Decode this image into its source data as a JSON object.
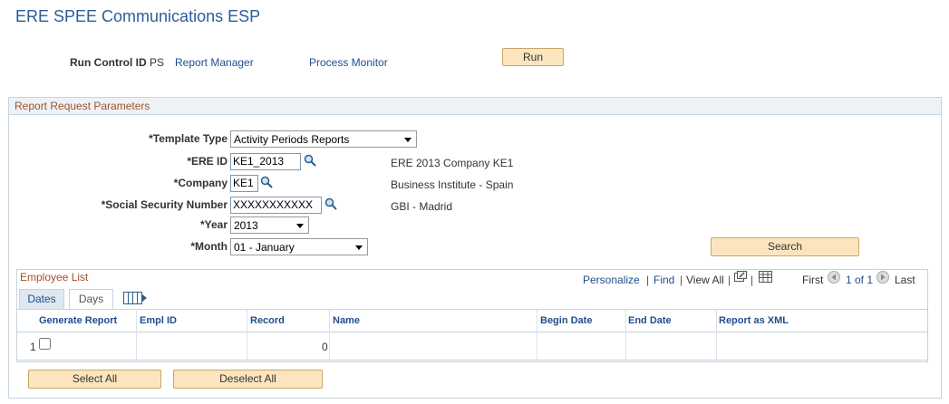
{
  "page": {
    "title": "ERE SPEE Communications ESP"
  },
  "header": {
    "run_control_label": "Run Control ID",
    "run_control_value": "PS",
    "report_manager": "Report Manager",
    "process_monitor": "Process Monitor",
    "run_button": "Run"
  },
  "params": {
    "section_title": "Report Request Parameters",
    "template_type_label": "*Template Type",
    "template_type_value": "Activity Periods Reports",
    "ere_id_label": "*ERE ID",
    "ere_id_value": "KE1_2013",
    "ere_id_desc": "ERE 2013 Company KE1",
    "company_label": "*Company",
    "company_value": "KE1",
    "company_desc": "Business Institute - Spain",
    "ssn_label": "*Social Security Number",
    "ssn_value": "XXXXXXXXXXX",
    "ssn_desc": "GBI - Madrid",
    "year_label": "*Year",
    "year_value": "2013",
    "month_label": "*Month",
    "month_value": "01 - January",
    "search_button": "Search"
  },
  "employee_list": {
    "title": "Employee List",
    "personalize": "Personalize",
    "find": "Find",
    "view_all": "View All",
    "first": "First",
    "page_info": "1 of 1",
    "last": "Last",
    "sep": "|",
    "tabs": [
      {
        "label": "Dates"
      },
      {
        "label": "Days"
      }
    ],
    "columns": [
      "Generate Report",
      "Empl ID",
      "Record",
      "Name",
      "Begin Date",
      "End Date",
      "Report as XML"
    ],
    "rows": [
      {
        "num": "1",
        "generate": false,
        "empl_id": "",
        "record": "0",
        "name": "",
        "begin_date": "",
        "end_date": "",
        "report_xml": ""
      }
    ]
  },
  "footer": {
    "select_all": "Select All",
    "deselect_all": "Deselect All"
  }
}
